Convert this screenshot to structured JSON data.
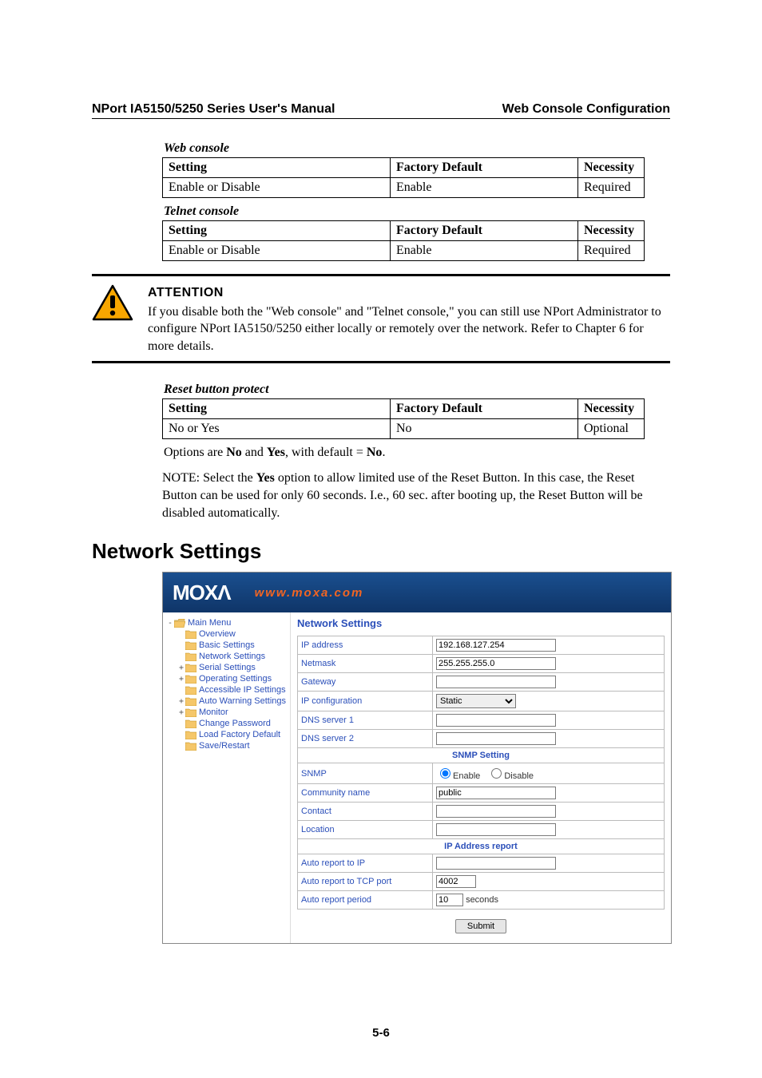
{
  "header": {
    "left": "NPort IA5150/5250 Series User's Manual",
    "right": "Web Console Configuration"
  },
  "tables": {
    "web_console": {
      "title": "Web console",
      "h1": "Setting",
      "h2": "Factory Default",
      "h3": "Necessity",
      "c1": "Enable or Disable",
      "c2": "Enable",
      "c3": "Required"
    },
    "telnet_console": {
      "title": "Telnet console",
      "h1": "Setting",
      "h2": "Factory Default",
      "h3": "Necessity",
      "c1": "Enable or Disable",
      "c2": "Enable",
      "c3": "Required"
    },
    "reset_button": {
      "title": "Reset button protect",
      "h1": "Setting",
      "h2": "Factory Default",
      "h3": "Necessity",
      "c1": "No or Yes",
      "c2": "No",
      "c3": "Optional"
    }
  },
  "attention": {
    "title": "ATTENTION",
    "body": "If you disable both the \"Web console\" and \"Telnet console,\" you can still use NPort Administrator to configure NPort IA5150/5250 either locally or remotely over the network. Refer to Chapter 6 for more details."
  },
  "options_note": {
    "pre": "Options are ",
    "b1": "No",
    "mid": " and ",
    "b2": "Yes",
    "mid2": ", with default = ",
    "b3": "No",
    "end": "."
  },
  "note_para": {
    "pre": "NOTE: Select the ",
    "b": "Yes",
    "post": " option to allow limited use of the Reset Button. In this case, the Reset Button can be used for only 60 seconds. I.e., 60 sec. after booting up, the Reset Button will be disabled automatically."
  },
  "h2": "Network Settings",
  "webshot": {
    "logo": "MOXA",
    "url": "www.moxa.com",
    "tree_root": "Main Menu",
    "tree": {
      "overview": "Overview",
      "basic": "Basic Settings",
      "network": "Network Settings",
      "serial": "Serial Settings",
      "operating": "Operating Settings",
      "accessible": "Accessible IP Settings",
      "autowarn": "Auto Warning Settings",
      "monitor": "Monitor",
      "changepw": "Change Password",
      "factory": "Load Factory Default",
      "save": "Save/Restart"
    },
    "form_title": "Network Settings",
    "rows": {
      "ip_label": "IP address",
      "ip_val": "192.168.127.254",
      "netmask_label": "Netmask",
      "netmask_val": "255.255.255.0",
      "gateway_label": "Gateway",
      "gateway_val": "",
      "ipconf_label": "IP configuration",
      "ipconf_val": "Static",
      "dns1_label": "DNS server 1",
      "dns1_val": "",
      "dns2_label": "DNS server 2",
      "dns2_val": "",
      "snmp_section": "SNMP Setting",
      "snmp_label": "SNMP",
      "snmp_enable": "Enable",
      "snmp_disable": "Disable",
      "community_label": "Community name",
      "community_val": "public",
      "contact_label": "Contact",
      "contact_val": "",
      "location_label": "Location",
      "location_val": "",
      "ipreport_section": "IP Address report",
      "autoip_label": "Auto report to IP",
      "autoip_val": "",
      "autotcp_label": "Auto report to TCP port",
      "autotcp_val": "4002",
      "autoperiod_label": "Auto report period",
      "autoperiod_val": "10",
      "autoperiod_unit": "seconds"
    },
    "submit": "Submit"
  },
  "page_num": "5-6"
}
